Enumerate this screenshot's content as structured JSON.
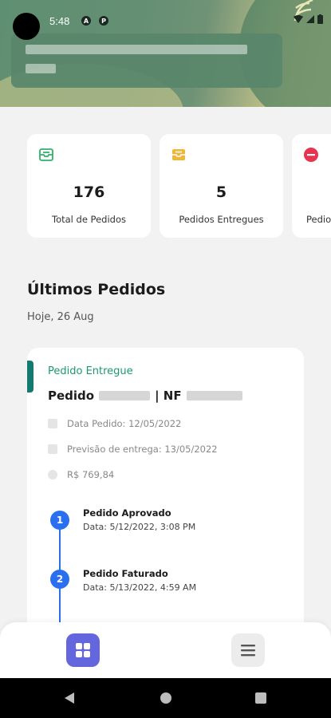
{
  "status_bar": {
    "time": "5:48",
    "icon1": "A",
    "icon2": "P"
  },
  "stats": [
    {
      "value": "176",
      "label": "Total de Pedidos",
      "icon": "inbox-icon",
      "color": "#2fb36b"
    },
    {
      "value": "5",
      "label": "Pedidos Entregues",
      "icon": "tray-icon",
      "color": "#f0b63a"
    },
    {
      "value": "",
      "label": "Pedio",
      "icon": "minus-circle-icon",
      "color": "#e8344e"
    }
  ],
  "section": {
    "title": "Últimos Pedidos",
    "date": "Hoje, 26 Aug"
  },
  "order": {
    "status": "Pedido Entregue",
    "title_prefix": "Pedido",
    "title_separator": "| NF",
    "order_date": "Data Pedido: 12/05/2022",
    "forecast": "Previsão de entrega: 13/05/2022",
    "amount": "R$ 769,84",
    "steps": [
      {
        "n": "1",
        "title": "Pedido Aprovado",
        "date": "Data: 5/12/2022, 3:08 PM"
      },
      {
        "n": "2",
        "title": "Pedido Faturado",
        "date": "Data: 5/13/2022, 4:59 AM"
      }
    ]
  },
  "colors": {
    "accent_green": "#1b9a6e",
    "timeline_blue": "#2a6ff0",
    "nav_active": "#6466dd"
  }
}
